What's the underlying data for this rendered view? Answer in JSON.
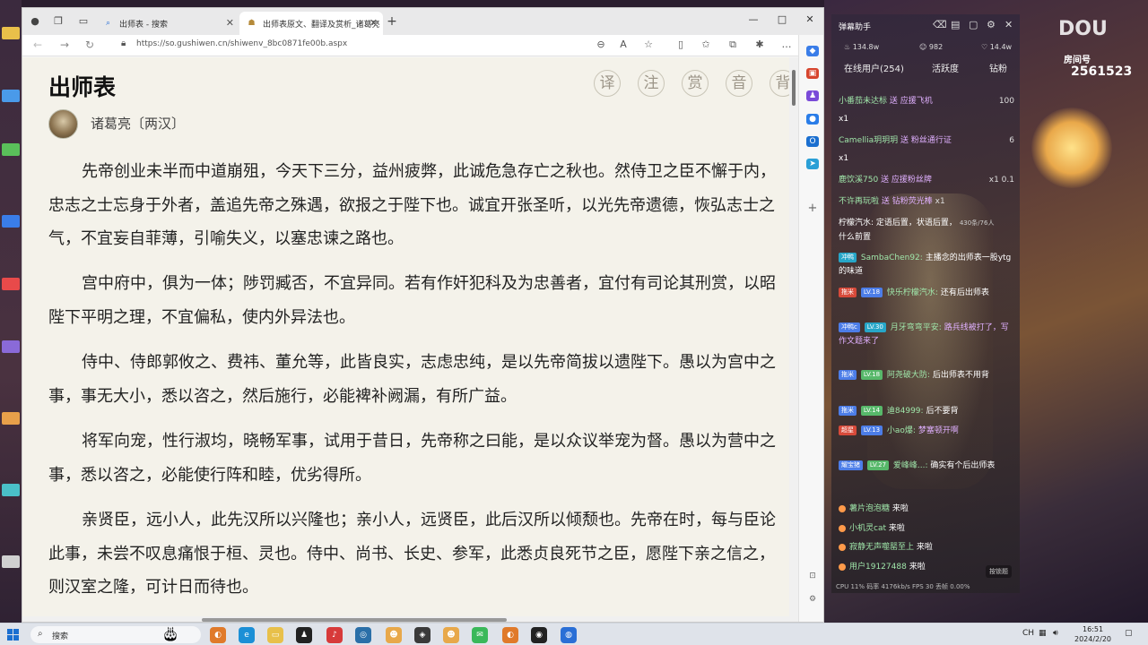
{
  "browser": {
    "tabs": [
      {
        "label": "出师表 - 搜索",
        "active": false
      },
      {
        "label": "出师表原文、翻译及赏析_诸葛亮",
        "active": true
      }
    ],
    "url": "https://so.gushiwen.cn/shiwenv_8bc0871fe00b.aspx"
  },
  "article": {
    "title": "出师表",
    "author": "诸葛亮〔两汉〕",
    "function_buttons": [
      "译",
      "注",
      "赏",
      "音",
      "背"
    ],
    "paragraphs": [
      "先帝创业未半而中道崩殂，今天下三分，益州疲弊，此诚危急存亡之秋也。然侍卫之臣不懈于内，忠志之士忘身于外者，盖追先帝之殊遇，欲报之于陛下也。诚宜开张圣听，以光先帝遗德，恢弘志士之气，不宜妄自菲薄，引喻失义，以塞忠谏之路也。",
      "宫中府中，俱为一体；陟罚臧否，不宜异同。若有作奸犯科及为忠善者，宜付有司论其刑赏，以昭陛下平明之理，不宜偏私，使内外异法也。",
      "侍中、侍郎郭攸之、费祎、董允等，此皆良实，志虑忠纯，是以先帝简拔以遗陛下。愚以为宫中之事，事无大小，悉以咨之，然后施行，必能裨补阙漏，有所广益。",
      "将军向宠，性行淑均，晓畅军事，试用于昔日，先帝称之曰能，是以众议举宠为督。愚以为营中之事，悉以咨之，必能使行阵和睦，优劣得所。",
      "亲贤臣，远小人，此先汉所以兴隆也；亲小人，远贤臣，此后汉所以倾颓也。先帝在时，每与臣论此事，未尝不叹息痛恨于桓、灵也。侍中、尚书、长史、参军，此悉贞良死节之臣，愿陛下亲之信之，则汉室之隆，可计日而待也。"
    ]
  },
  "danmu_panel": {
    "title": "弹幕助手",
    "stats": {
      "hot": "134.8w",
      "fans": "982",
      "likes": "14.4w"
    },
    "tabs": [
      "在线用户(254)",
      "活跃度",
      "钻粉"
    ],
    "messages": [
      {
        "user": "小番茄未达标",
        "action": "送 应援飞机",
        "extra": "100"
      },
      {
        "user": "",
        "action": "x1",
        "extra": ""
      },
      {
        "user": "Camellia玥玥玥",
        "action": "送 粉丝通行证",
        "extra": "6"
      },
      {
        "user": "",
        "action": "x1",
        "extra": ""
      },
      {
        "user": "鹿饮溪750",
        "action": "送 应援粉丝牌",
        "extra": "x1  0.1"
      },
      {
        "user": "不许再玩啦",
        "action": "送 钻粉荧光棒",
        "extra": "x1"
      },
      {
        "user": "柠檬汽水:",
        "action": "定语后置，状语后置，",
        "extra": "430条/76人"
      },
      {
        "user": "",
        "action": "什么前置",
        "extra": ""
      }
    ],
    "chats": [
      {
        "badge": "冲鸭",
        "level": "",
        "user": "SambaChen92:",
        "text": "主播念的出师表一股ytg的味道"
      },
      {
        "badge": "拖米",
        "level": "LV.18",
        "user": "快乐柠檬汽水:",
        "text": "还有后出师表"
      },
      {
        "badge": "冲鸭c",
        "level": "LV.30",
        "user": "月牙弯弯平安:",
        "text": "路兵线被打了，写作文题来了"
      },
      {
        "badge": "拖米",
        "level": "LV.18",
        "user": "阿尧破大防:",
        "text": "后出师表不用背"
      },
      {
        "badge": "拖米",
        "level": "LV.14",
        "user": "迪84999:",
        "text": "后不要背"
      },
      {
        "badge": "超星",
        "level": "LV.13",
        "user": "小ao爆:",
        "text": "梦塞顿开啊"
      },
      {
        "badge": "耀宝猪",
        "level": "LV.27",
        "user": "爱峰峰...:",
        "text": "确实有个后出师表"
      }
    ],
    "enters": [
      {
        "user": "薯片泡泡糖",
        "text": "来啦"
      },
      {
        "user": "小机灵cat",
        "text": "来啦"
      },
      {
        "user": "寂静无声噬罂至上",
        "text": "来啦"
      },
      {
        "user": "用户19127488",
        "text": "来啦"
      }
    ],
    "lock_label": "按锁题",
    "footer": "CPU 11%   码率 4176kb/s  FPS 30        丢帧 0.00%"
  },
  "stream": {
    "room_label": "房间号",
    "room_number": "2561523"
  },
  "taskbar": {
    "search_placeholder": "搜索",
    "time": "16:51",
    "date": "2024/2/20"
  }
}
